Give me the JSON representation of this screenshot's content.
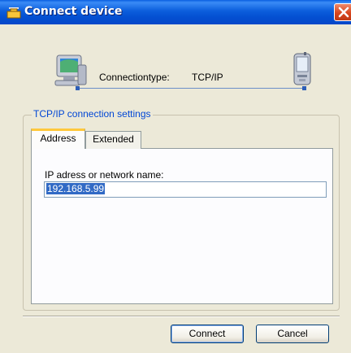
{
  "window": {
    "title": "Connect device",
    "close_icon": "close-icon",
    "app_icon": "connect-device-icon"
  },
  "connection": {
    "label": "Connectiontype:",
    "value": "TCP/IP",
    "left_icon": "computer-icon",
    "right_icon": "pda-icon"
  },
  "settings": {
    "legend": "TCP/IP connection settings",
    "tabs": [
      {
        "label": "Address",
        "active": true
      },
      {
        "label": "Extended",
        "active": false
      }
    ],
    "address": {
      "field_label": "IP adress or network name:",
      "field_value": "192.168.5.99"
    }
  },
  "buttons": {
    "connect": "Connect",
    "cancel": "Cancel"
  },
  "colors": {
    "titlebar": "#0553D6",
    "legend": "#0046D5",
    "selection": "#316AC5",
    "tab_highlight": "#FFC83C"
  }
}
